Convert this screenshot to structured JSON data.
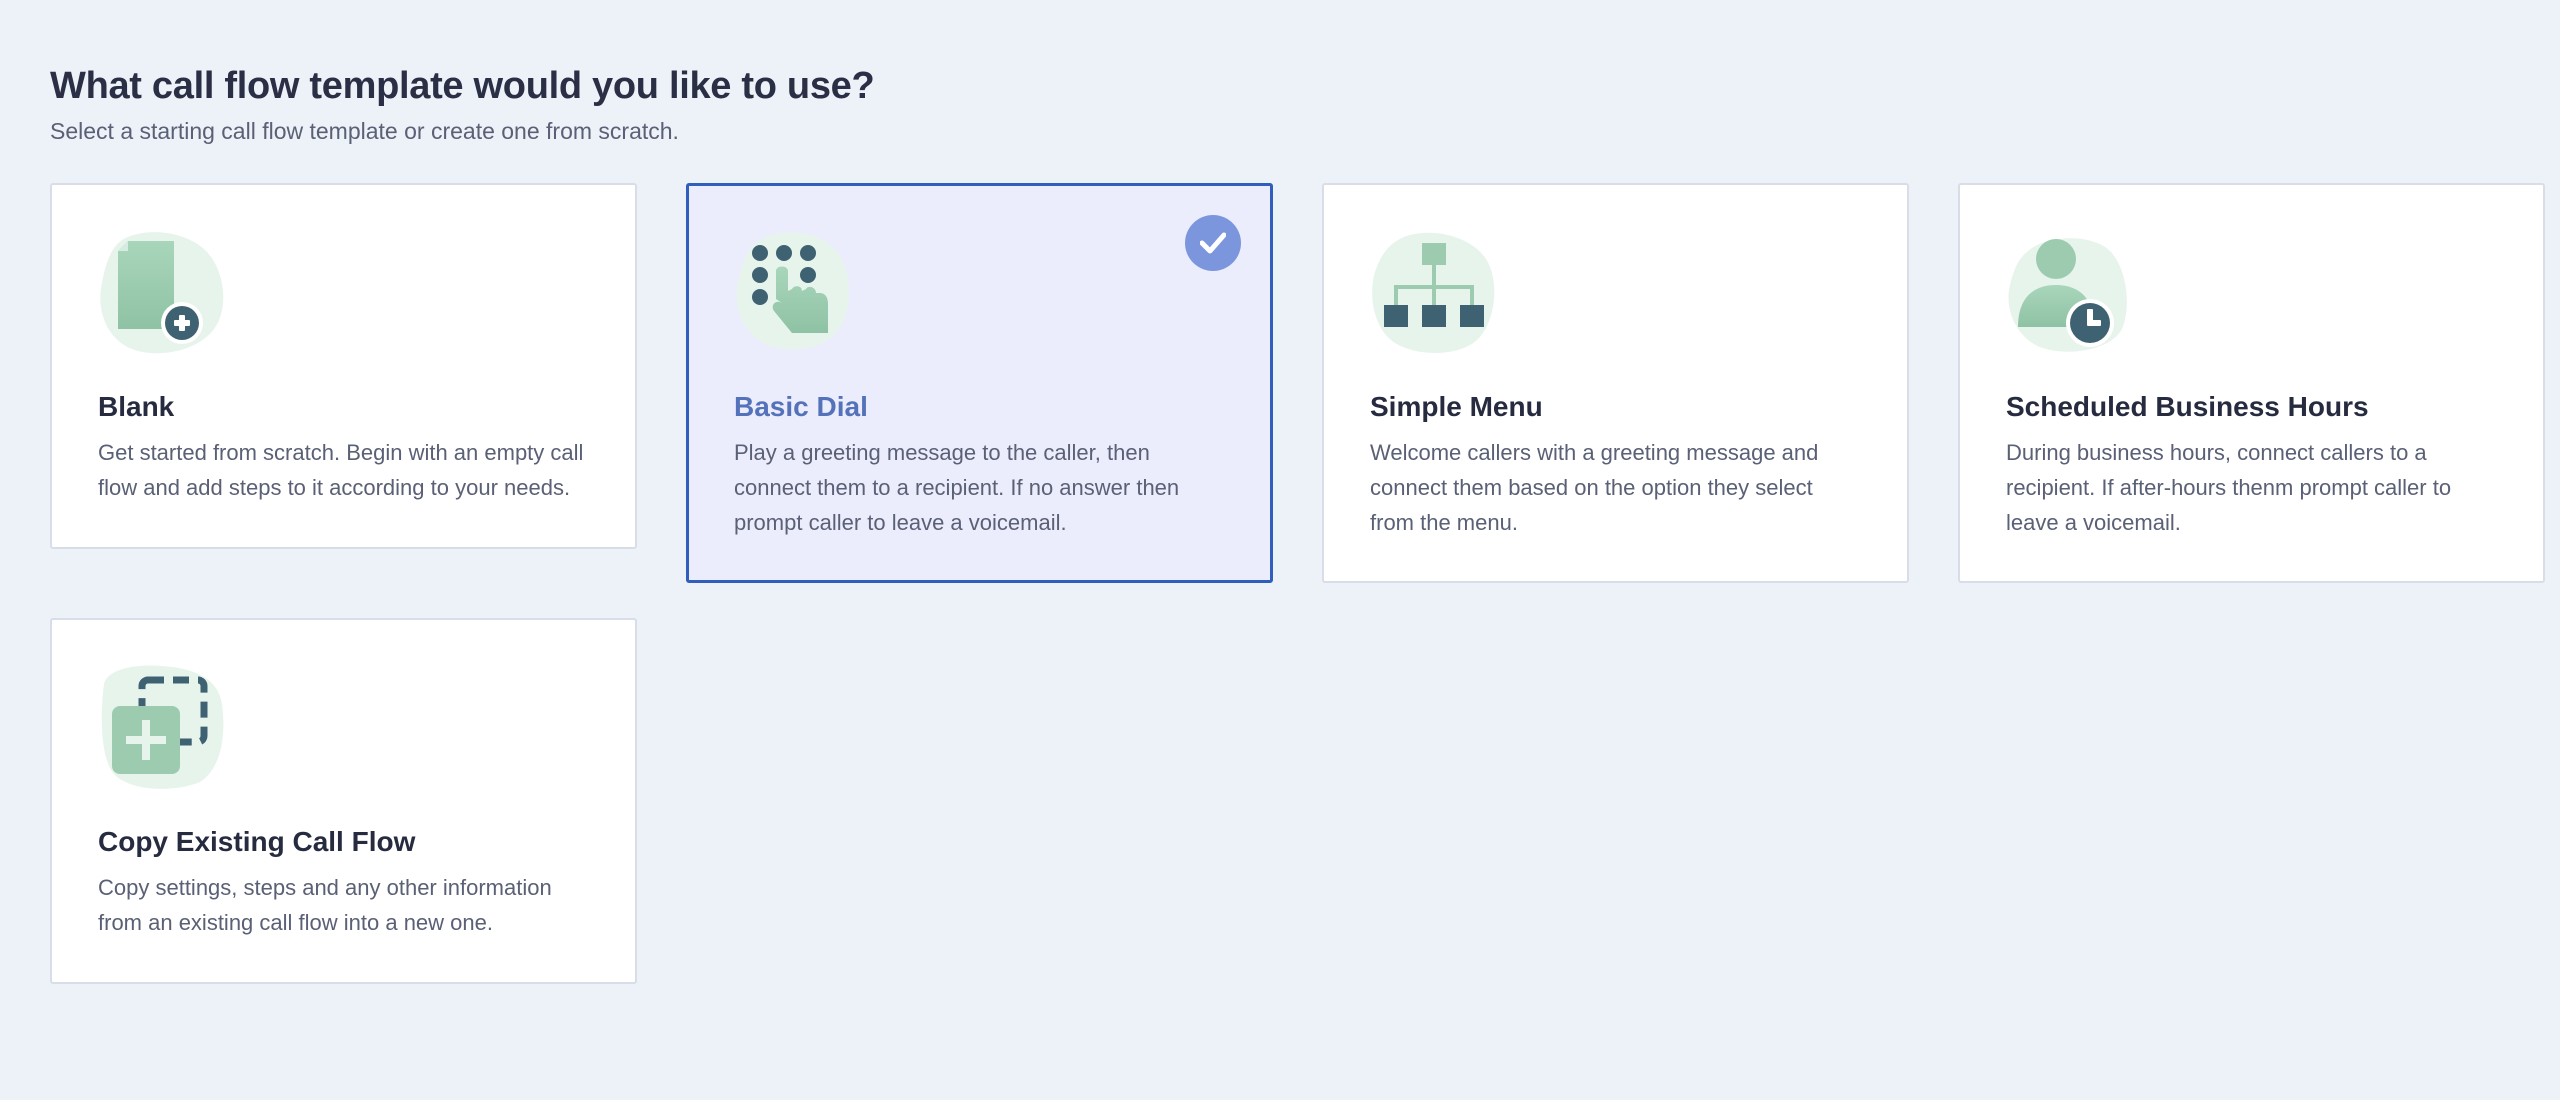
{
  "header": {
    "title": "What call flow template would you like to use?",
    "subtitle": "Select a starting call flow template or create one from scratch."
  },
  "colors": {
    "background": "#edf1f8",
    "selected_border": "#2f5ebd",
    "selected_background": "#ecedfc",
    "selected_title": "#5472ba",
    "check_badge": "#7b96dd",
    "icon_green": "#9ccbb0",
    "icon_dark": "#3f6273"
  },
  "templates": [
    {
      "id": "blank",
      "title": "Blank",
      "description": "Get started from scratch. Begin with an empty call flow and add steps to it according to your needs.",
      "icon": "blank-document-plus-icon",
      "selected": false
    },
    {
      "id": "basic-dial",
      "title": "Basic Dial",
      "description": "Play a greeting message to the caller, then connect them to a recipient. If no answer then prompt caller to leave a voicemail.",
      "icon": "keypad-hand-icon",
      "selected": true
    },
    {
      "id": "simple-menu",
      "title": "Simple Menu",
      "description": "Welcome callers with a greeting message and connect them based on the option they select from the menu.",
      "icon": "org-chart-menu-icon",
      "selected": false
    },
    {
      "id": "scheduled-business-hours",
      "title": "Scheduled Business Hours",
      "description": "During business hours, connect callers to a recipient. If after-hours thenm prompt caller to leave a voicemail.",
      "icon": "person-clock-icon",
      "selected": false
    },
    {
      "id": "copy-existing",
      "title": "Copy Existing Call Flow",
      "description": "Copy settings, steps and any other information from an existing call flow into a new one.",
      "icon": "copy-plus-icon",
      "selected": false
    }
  ]
}
